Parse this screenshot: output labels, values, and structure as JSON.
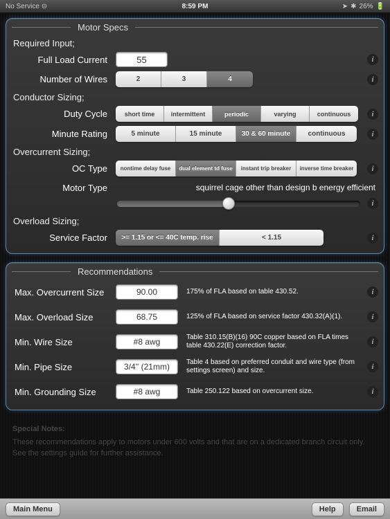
{
  "status": {
    "left": "No Service",
    "wifi": "⊝",
    "time": "8:59 PM",
    "loc": "➤",
    "bt": "✱",
    "batt": "26%"
  },
  "panel1": {
    "title": "Motor Specs",
    "sections": {
      "req": "Required Input;",
      "cond": "Conductor Sizing;",
      "oc": "Overcurrent Sizing;",
      "ol": "Overload Sizing;"
    },
    "flc": {
      "label": "Full Load Current",
      "value": "55"
    },
    "wires": {
      "label": "Number of Wires",
      "opts": [
        "2",
        "3",
        "4"
      ],
      "sel": 2
    },
    "duty": {
      "label": "Duty Cycle",
      "opts": [
        "short time",
        "intermittent",
        "periodic",
        "varying",
        "continuous"
      ],
      "sel": 2
    },
    "minute": {
      "label": "Minute Rating",
      "opts": [
        "5 minute",
        "15 minute",
        "30 & 60 minute",
        "continuous"
      ],
      "sel": 2
    },
    "octype": {
      "label": "OC Type",
      "opts": [
        "nontime delay fuse",
        "dual element td fuse",
        "instant trip breaker",
        "inverse time breaker"
      ],
      "sel": 1
    },
    "motor": {
      "label": "Motor Type",
      "value": "squirrel cage other than design b energy efficient"
    },
    "sf": {
      "label": "Service Factor",
      "opts": [
        ">= 1.15 or <= 40C temp. rise",
        "< 1.15"
      ],
      "sel": 0
    }
  },
  "panel2": {
    "title": "Recommendations",
    "rows": [
      {
        "label": "Max. Overcurrent Size",
        "value": "90.00",
        "desc": "175% of FLA based on table 430.52."
      },
      {
        "label": "Max. Overload Size",
        "value": "68.75",
        "desc": "125% of FLA based on service factor 430.32(A)(1)."
      },
      {
        "label": "Min. Wire Size",
        "value": "#8 awg",
        "desc": "Table 310.15(B)(16) 90C copper based on FLA times table 430.22(E) correction factor."
      },
      {
        "label": "Min. Pipe Size",
        "value": "3/4'' (21mm)",
        "desc": "Table 4 based on preferred conduit and wire type (from settings screen) and size."
      },
      {
        "label": "Min. Grounding Size",
        "value": "#8 awg",
        "desc": "Table 250.122 based on overcurrent size."
      }
    ]
  },
  "notes": {
    "title": "Special Notes:",
    "body": "These recommendations apply to motors under 600 volts and that are on a dedicated branch circuit only. See the settings guide for further assistance."
  },
  "toolbar": {
    "main": "Main Menu",
    "help": "Help",
    "email": "Email"
  },
  "info": "i"
}
